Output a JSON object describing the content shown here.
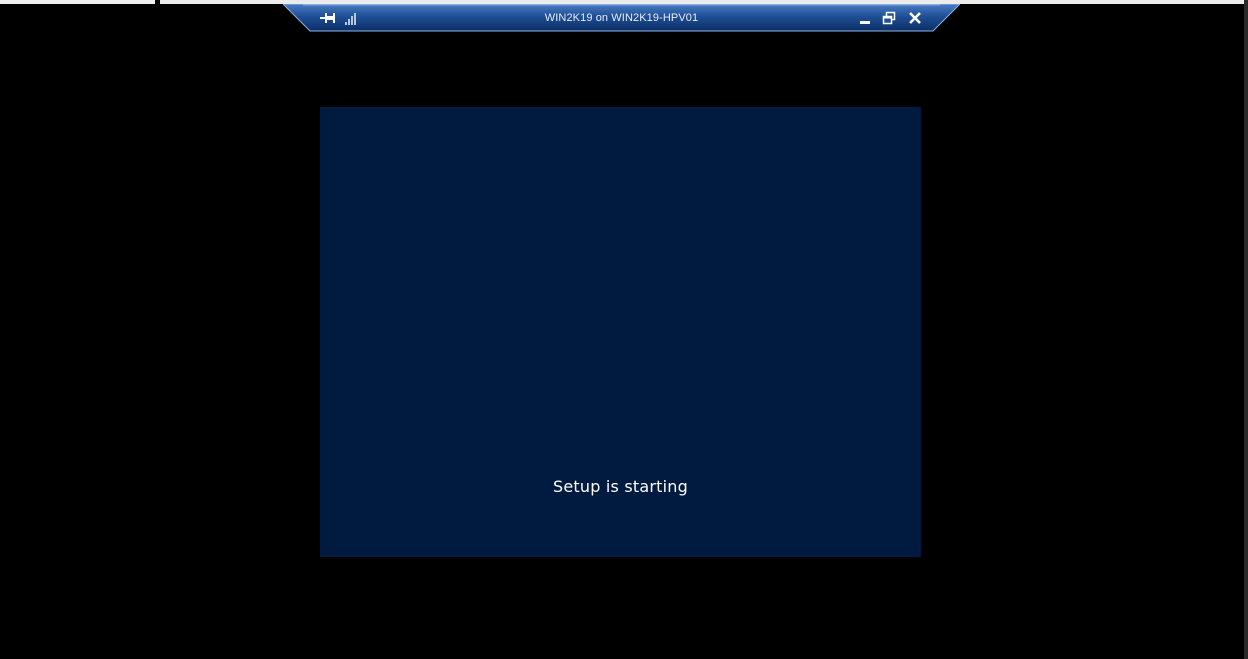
{
  "connection_bar": {
    "title": "WIN2K19 on WIN2K19-HPV01",
    "icons": {
      "pin": "pin-icon",
      "signal": "signal-strength-icon",
      "minimize": "minimize-icon",
      "restore": "restore-icon",
      "close": "close-icon"
    },
    "colors": {
      "gradient_top": "#3a6bb5",
      "gradient_bottom": "#0f3a7a",
      "border": "#7fa6e0"
    }
  },
  "vm_screen": {
    "status_text": "Setup is starting",
    "background_color": "#001a40"
  }
}
